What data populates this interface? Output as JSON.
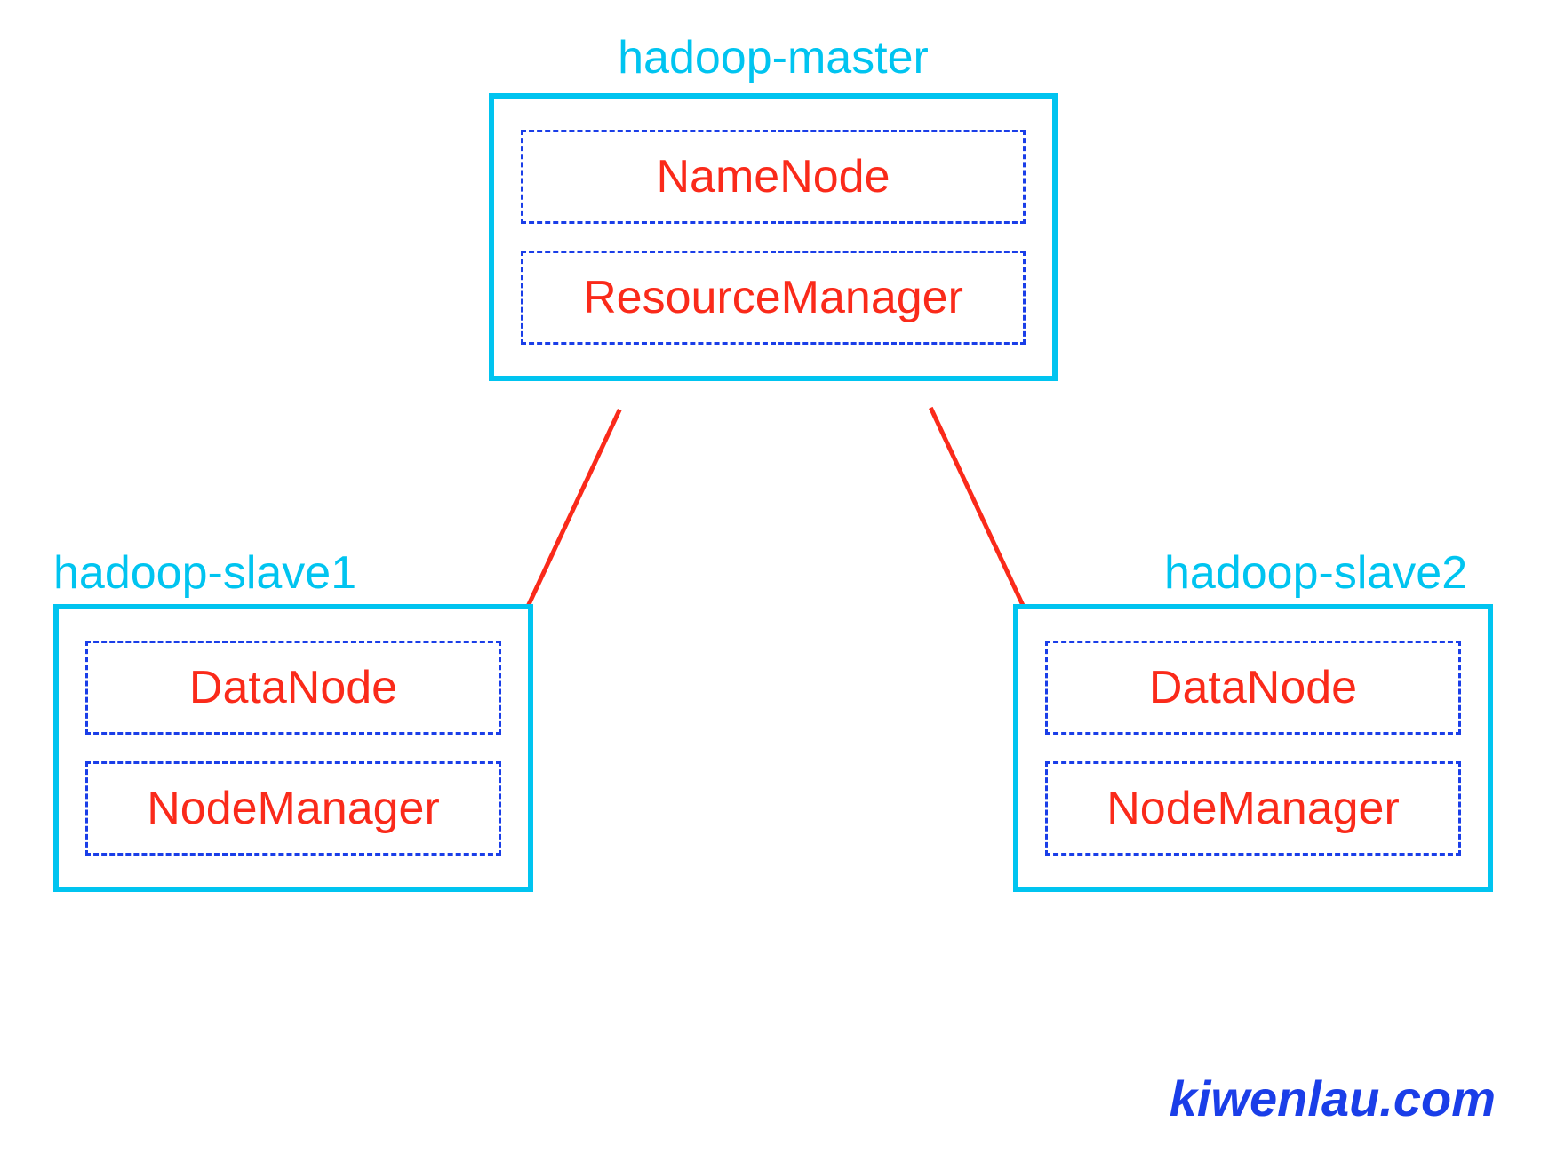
{
  "master": {
    "title": "hadoop-master",
    "components": {
      "namenode": "NameNode",
      "resourcemanager": "ResourceManager"
    }
  },
  "slave1": {
    "title": "hadoop-slave1",
    "components": {
      "datanode": "DataNode",
      "nodemanager": "NodeManager"
    }
  },
  "slave2": {
    "title": "hadoop-slave2",
    "components": {
      "datanode": "DataNode",
      "nodemanager": "NodeManager"
    }
  },
  "watermark": "kiwenlau.com",
  "colors": {
    "node_border": "#00c4f0",
    "node_title": "#00c4f0",
    "component_border": "#1a3ee8",
    "component_text": "#fa2a1a",
    "connector": "#fa2a1a",
    "watermark": "#1a3ee8"
  }
}
